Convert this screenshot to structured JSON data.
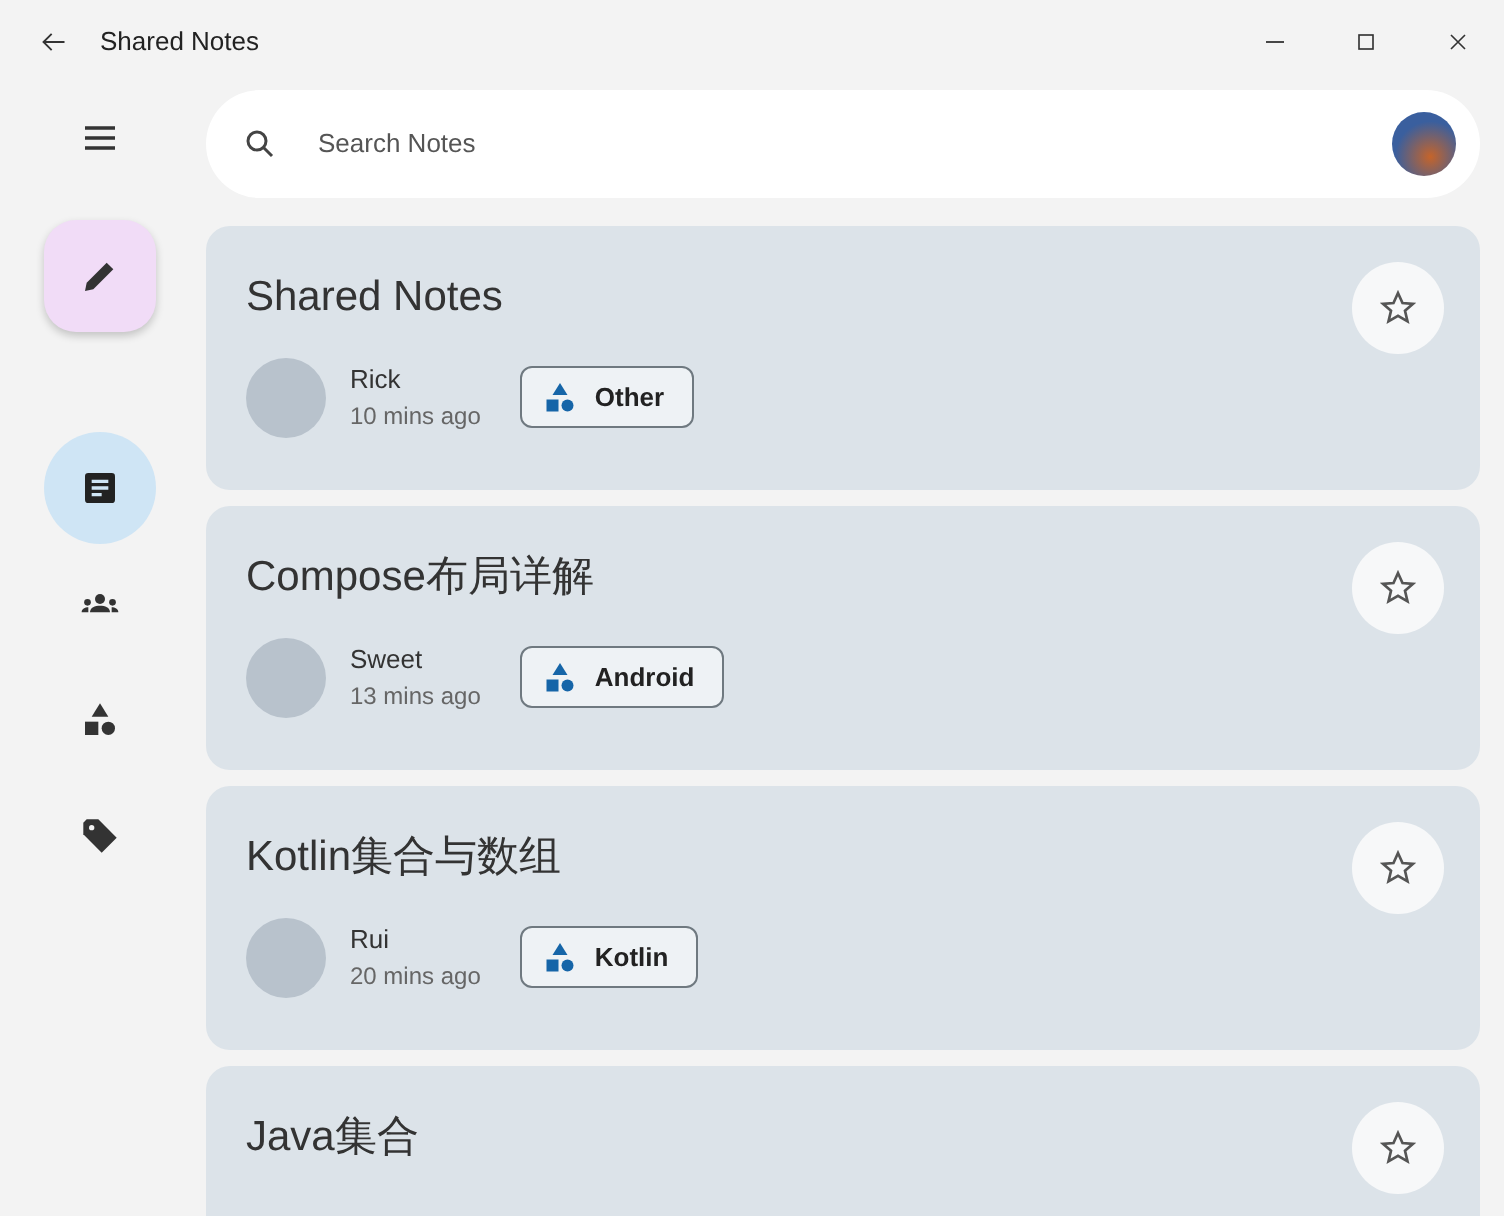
{
  "window": {
    "title": "Shared Notes"
  },
  "rail": {
    "items": [
      {
        "kind": "notes",
        "selected": true
      },
      {
        "kind": "people",
        "selected": false
      },
      {
        "kind": "shapes",
        "selected": false
      },
      {
        "kind": "tag",
        "selected": false
      }
    ]
  },
  "search": {
    "placeholder": "Search Notes"
  },
  "notes": [
    {
      "title": "Shared Notes",
      "author": "Rick",
      "time": "10 mins ago",
      "tag": "Other",
      "favorite": false
    },
    {
      "title": "Compose布局详解",
      "author": "Sweet",
      "time": "13 mins ago",
      "tag": "Android",
      "favorite": false
    },
    {
      "title": "Kotlin集合与数组",
      "author": "Rui",
      "time": "20 mins ago",
      "tag": "Kotlin",
      "favorite": false
    },
    {
      "title": "Java集合",
      "favorite": false
    }
  ]
}
